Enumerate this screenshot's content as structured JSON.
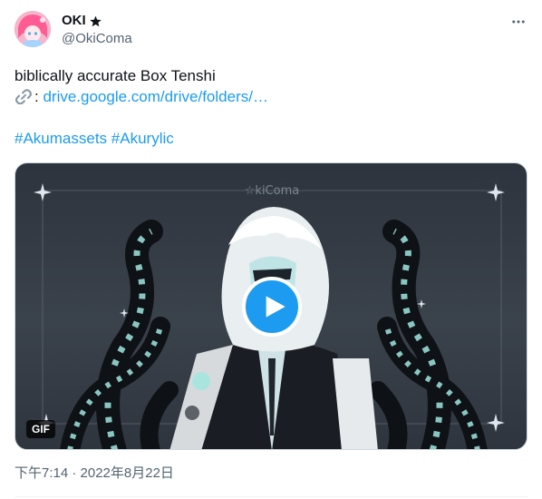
{
  "author": {
    "display_name": "OKI",
    "badge_icon": "star-icon",
    "handle": "@OkiComa"
  },
  "menu": {
    "icon": "more-horizontal-icon"
  },
  "tweet": {
    "text_line1": "biblically accurate Box Tenshi",
    "link_emoji": "link-icon",
    "link_prefix": ": ",
    "link_text": "drive.google.com/drive/folders/…",
    "hashtag1": "#Akumassets",
    "hashtag2": "#Akurylic"
  },
  "media": {
    "type_badge": "GIF",
    "play_icon": "play-icon",
    "watermark": "☆kiComa"
  },
  "timestamp": "下午7:14 · 2022年8月22日",
  "colors": {
    "accent": "#1d9bf0",
    "text": "#0f1419",
    "secondary": "#536471"
  }
}
